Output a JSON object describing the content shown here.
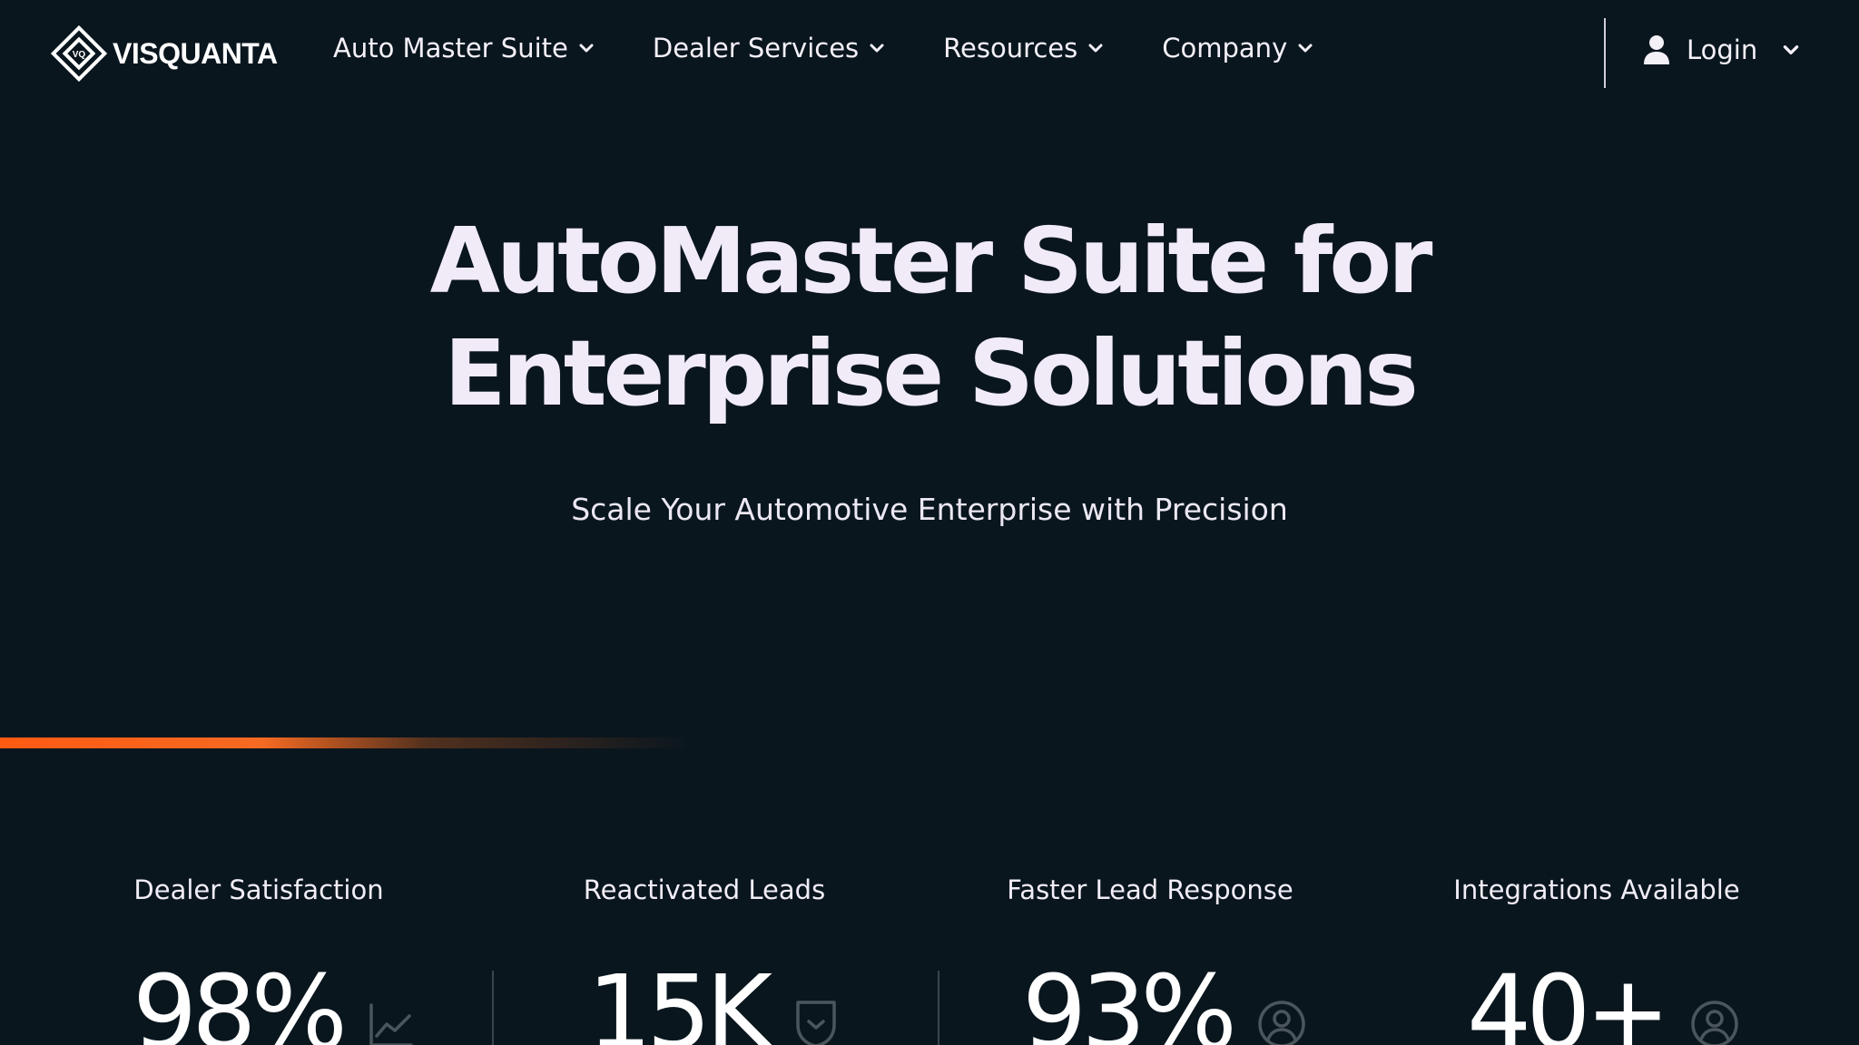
{
  "brand": {
    "name": "VISQUANTA"
  },
  "nav": {
    "items": [
      {
        "label": "Auto Master Suite"
      },
      {
        "label": "Dealer Services"
      },
      {
        "label": "Resources"
      },
      {
        "label": "Company"
      }
    ],
    "login_label": "Login"
  },
  "hero": {
    "title_line1": "AutoMaster Suite for",
    "title_line2": "Enterprise Solutions",
    "subtitle": "Scale Your Automotive Enterprise with Precision"
  },
  "stats": [
    {
      "label": "Dealer Satisfaction",
      "value": "98%",
      "icon": "line-chart-icon"
    },
    {
      "label": "Reactivated Leads",
      "value": "15K",
      "icon": "shield-check-icon"
    },
    {
      "label": "Faster Lead Response",
      "value": "93%",
      "icon": "user-circle-icon"
    },
    {
      "label": "Integrations Available",
      "value": "40+",
      "icon": "user-circle-icon"
    }
  ],
  "colors": {
    "background": "#0a161e",
    "accent": "#ff5a12",
    "text": "#f1ebf8",
    "muted_icon": "#4b555c"
  }
}
